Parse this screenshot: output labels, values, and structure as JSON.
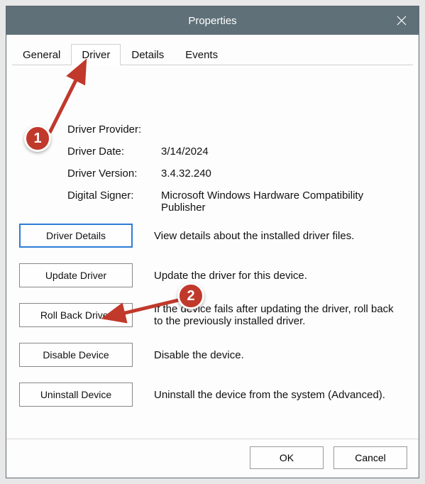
{
  "window": {
    "title": "Properties"
  },
  "tabs": [
    {
      "label": "General",
      "active": false
    },
    {
      "label": "Driver",
      "active": true
    },
    {
      "label": "Details",
      "active": false
    },
    {
      "label": "Events",
      "active": false
    }
  ],
  "driver_info": {
    "provider_label": "Driver Provider:",
    "provider_value": "",
    "date_label": "Driver Date:",
    "date_value": "3/14/2024",
    "version_label": "Driver Version:",
    "version_value": "3.4.32.240",
    "signer_label": "Digital Signer:",
    "signer_value": "Microsoft Windows Hardware Compatibility Publisher"
  },
  "actions": {
    "details": {
      "button": "Driver Details",
      "desc": "View details about the installed driver files."
    },
    "update": {
      "button": "Update Driver",
      "desc": "Update the driver for this device."
    },
    "rollback": {
      "button": "Roll Back Driver",
      "desc": "If the device fails after updating the driver, roll back to the previously installed driver."
    },
    "disable": {
      "button": "Disable Device",
      "desc": "Disable the device."
    },
    "uninstall": {
      "button": "Uninstall Device",
      "desc": "Uninstall the device from the system (Advanced)."
    }
  },
  "footer": {
    "ok": "OK",
    "cancel": "Cancel"
  },
  "annotations": {
    "marker1": "1",
    "marker2": "2"
  }
}
